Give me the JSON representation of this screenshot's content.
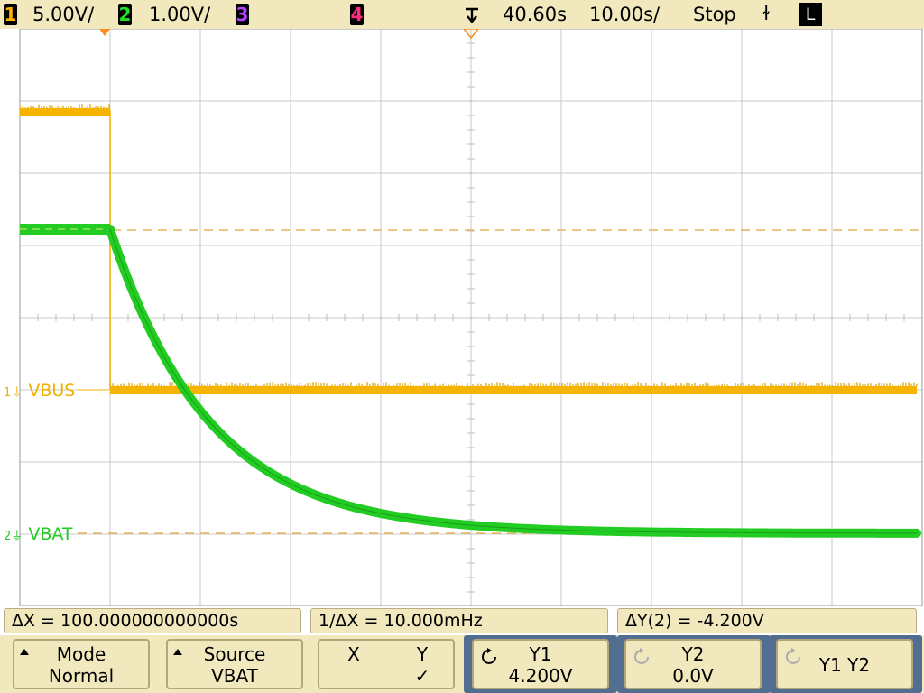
{
  "topbar": {
    "ch1": {
      "num": "1",
      "scale": "5.00V/",
      "color": "#ffb000"
    },
    "ch2": {
      "num": "2",
      "scale": "1.00V/",
      "color": "#22dd22"
    },
    "ch3": {
      "num": "3",
      "color": "#b040ff"
    },
    "ch4": {
      "num": "4",
      "color": "#ff2a7a"
    },
    "trigger_delay": "40.60s",
    "timebase": "10.00s/",
    "run_state": "Stop",
    "trigger_slope": "ɫ",
    "trigger_mode": "L"
  },
  "traces": {
    "vbus": {
      "marker": "1",
      "label": "VBUS",
      "color": "#f0b000"
    },
    "vbat": {
      "marker": "2",
      "label": "VBAT",
      "color": "#22cc22"
    }
  },
  "measurements": {
    "delta_x": "ΔX = 100.000000000000s",
    "inv_delta_x": "1/ΔX = 10.000mHz",
    "delta_y": "ΔY(2) = -4.200V"
  },
  "softkeys": {
    "mode": {
      "line1": "Mode",
      "line2": "Normal"
    },
    "source": {
      "line1": "Source",
      "line2": "VBAT"
    },
    "xy": {
      "x_label": "X",
      "y_label": "Y",
      "y_check": "✓"
    },
    "y1": {
      "line1": "Y1",
      "line2": "4.200V"
    },
    "y2": {
      "line1": "Y2",
      "line2": "0.0V"
    },
    "y1y2": {
      "line1": "Y1 Y2"
    }
  },
  "icons": {
    "knob": "rotate-knob-icon",
    "trigger": "trigger-position-icon"
  }
}
